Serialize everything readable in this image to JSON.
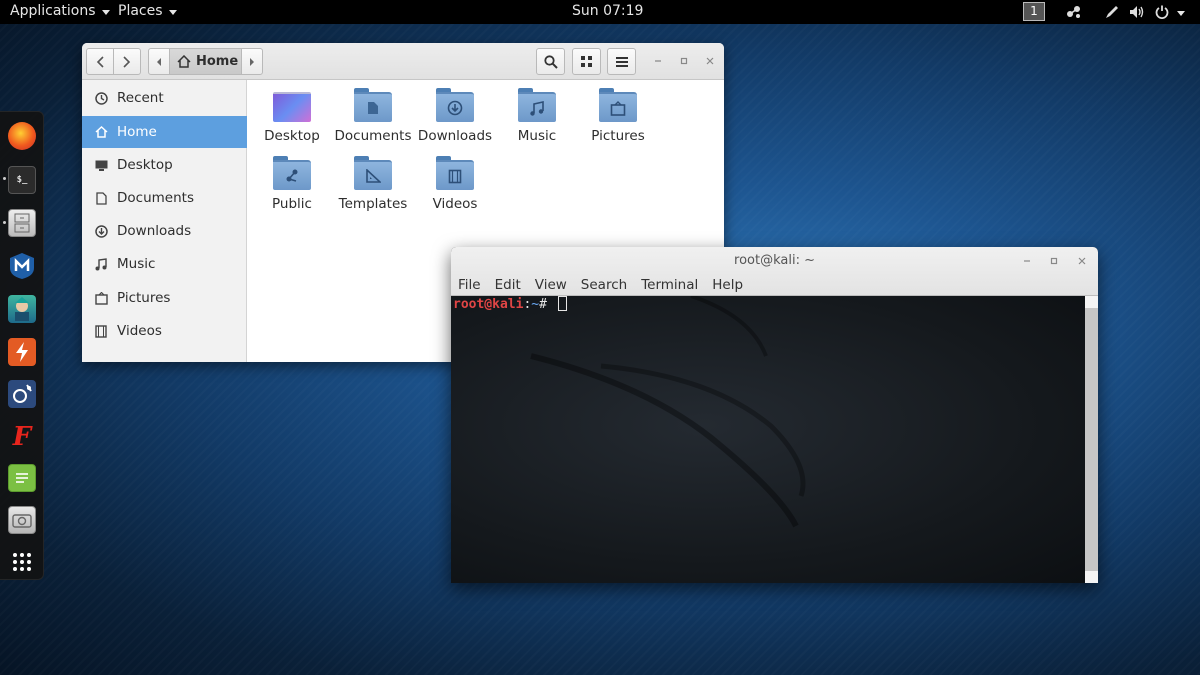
{
  "topbar": {
    "applications": "Applications",
    "places": "Places",
    "clock": "Sun 07:19",
    "workspace": "1",
    "tray_icons": [
      "network-icon",
      "pen-icon",
      "volume-icon",
      "power-icon"
    ]
  },
  "dock": {
    "apps": [
      {
        "name": "firefox-icon",
        "color": "#f0591e"
      },
      {
        "name": "terminal-icon",
        "color": "#2b2b2b"
      },
      {
        "name": "files-cabinet-icon",
        "color": "#d8d8d8"
      },
      {
        "name": "metasploit-icon",
        "color": "#1f5fa8"
      },
      {
        "name": "armitage-icon",
        "color": "#1e8a6a"
      },
      {
        "name": "burpsuite-icon",
        "color": "#e35b24"
      },
      {
        "name": "beef-icon",
        "color": "#2c4a7d"
      },
      {
        "name": "faraday-icon",
        "color": "#d62b21"
      },
      {
        "name": "leafpad-icon",
        "color": "#7bc043"
      },
      {
        "name": "screenshot-icon",
        "color": "#c9c9c9"
      },
      {
        "name": "show-apps-icon",
        "color": "#ffffff"
      }
    ]
  },
  "files": {
    "location": "Home",
    "sidebar": [
      {
        "label": "Recent",
        "icon": "clock-icon"
      },
      {
        "label": "Home",
        "icon": "home-icon",
        "active": true
      },
      {
        "label": "Desktop",
        "icon": "desktop-icon"
      },
      {
        "label": "Documents",
        "icon": "document-icon"
      },
      {
        "label": "Downloads",
        "icon": "download-icon"
      },
      {
        "label": "Music",
        "icon": "music-icon"
      },
      {
        "label": "Pictures",
        "icon": "pictures-icon"
      },
      {
        "label": "Videos",
        "icon": "video-icon"
      }
    ],
    "folders": [
      {
        "label": "Desktop",
        "icon": "desktop-folder-icon"
      },
      {
        "label": "Documents",
        "icon": "documents-folder-icon"
      },
      {
        "label": "Downloads",
        "icon": "downloads-folder-icon"
      },
      {
        "label": "Music",
        "icon": "music-folder-icon"
      },
      {
        "label": "Pictures",
        "icon": "pictures-folder-icon"
      },
      {
        "label": "Public",
        "icon": "public-folder-icon"
      },
      {
        "label": "Templates",
        "icon": "templates-folder-icon"
      },
      {
        "label": "Videos",
        "icon": "videos-folder-icon"
      }
    ]
  },
  "terminal": {
    "title": "root@kali: ~",
    "menu": [
      "File",
      "Edit",
      "View",
      "Search",
      "Terminal",
      "Help"
    ],
    "prompt_user": "root@kali",
    "prompt_sep": ":",
    "prompt_path": "~",
    "prompt_symbol": "# "
  }
}
